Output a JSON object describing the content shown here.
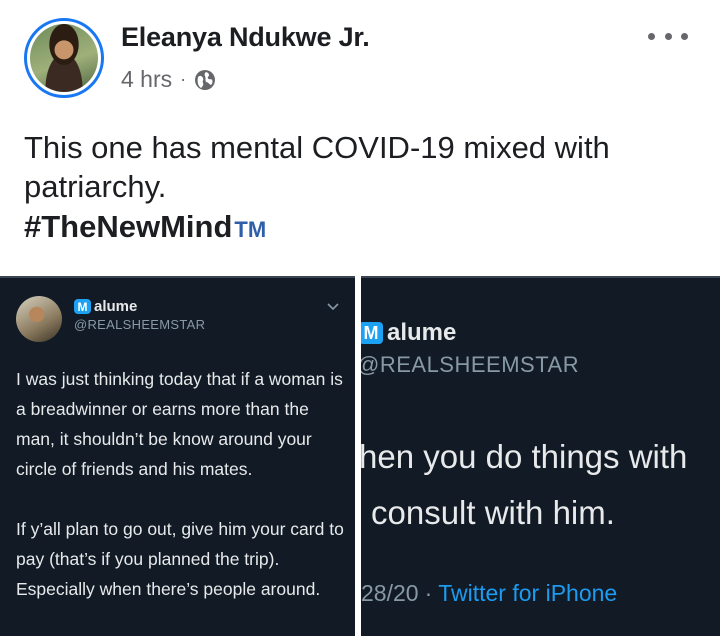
{
  "post": {
    "author": "Eleanya Ndukwe Jr.",
    "time": "4 hrs",
    "separator": "·",
    "privacy_icon": "globe-icon",
    "more_icon": "more-options-icon",
    "text": "This one has mental COVID-19 mixed with patriarchy.",
    "hashtag": "#TheNewMind",
    "hashtag_suffix": "TM"
  },
  "left_tweet": {
    "badge": "M",
    "name": "alume",
    "handle": "@REALSHEEMSTAR",
    "paragraph1": "I was just thinking today that if a woman is a breadwinner or earns more than the man, it shouldn’t be know around your circle of friends and his mates.",
    "paragraph2": "If y’all plan to go out, give him your card to pay (that’s if you planned the trip). Especially when there’s people around."
  },
  "right_tweet": {
    "badge": "M",
    "name": "alume",
    "handle": "@REALSHEEMSTAR",
    "line1": "hen you do things with",
    "line2": "consult with him.",
    "date": "28/20",
    "separator": "·",
    "source": "Twitter for iPhone"
  },
  "colors": {
    "accent": "#1877f2",
    "tweet_bg": "#111a25",
    "twitter_blue": "#1d9bf0"
  }
}
